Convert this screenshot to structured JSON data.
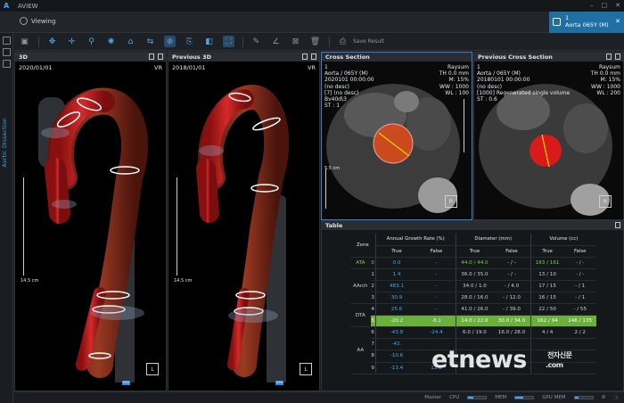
{
  "app": {
    "title": "AVIEW",
    "mode_label": "Viewing"
  },
  "window_controls": [
    "–",
    "□",
    "✕"
  ],
  "patient_tab": {
    "line1": "1",
    "line2": "Aorta 065Y (M)"
  },
  "rail": {
    "vertical_label": "Aortic Dissection"
  },
  "toolbar": {
    "icons": [
      "select-icon",
      "pointer-icon",
      "move-icon",
      "zoom-icon",
      "brightness-icon",
      "roi-icon",
      "measure-icon",
      "crosshair-icon",
      "export-icon",
      "overlay-icon",
      "fit-icon",
      "erase-icon",
      "angle-icon",
      "delete-image-icon",
      "trash-icon"
    ],
    "save_label": "Save Result"
  },
  "panels": {
    "p3d": {
      "title": "3D",
      "date": "2020/01/01",
      "mode": "VR",
      "scale": "14.5 cm",
      "orient": "L"
    },
    "prev3d": {
      "title": "Previous 3D",
      "date": "2018/01/01",
      "mode": "VR",
      "scale": "14.5 cm",
      "orient": "L"
    },
    "cross": {
      "title": "Cross Section",
      "tl": [
        "1",
        "Aorta / 065Y (M)",
        "2020101 00:00:00",
        "(no desc)",
        "[7] (no desc)",
        "Bv40d\\3",
        "ST : 1"
      ],
      "tr": [
        "Raysum",
        "TH 0.0 mm",
        "M: 15%",
        "WW : 1000",
        "WL : 100"
      ],
      "scale": "5.5 cm"
    },
    "prevcross": {
      "title": "Previous Cross Section",
      "tl": [
        "1",
        "Aorta / 065Y (M)",
        "20180101 00:00:00",
        "(no desc)",
        "[1000] Regenerated single volume",
        "ST : 0.6"
      ],
      "tr": [
        "Raysum",
        "TH 0.0 mm",
        "M: 15%",
        "WW : 1000",
        "WL : 200"
      ]
    },
    "table_title": "Table"
  },
  "table": {
    "headers": {
      "zone": "Zone",
      "growth": "Annual Growth Rate (%)",
      "diameter": "Diameter (mm)",
      "volume": "Volume (cc)",
      "true": "True",
      "false": "False"
    },
    "rows": [
      {
        "group": "ATA",
        "zone": "0",
        "g_true": "0.0",
        "g_false": "-",
        "d_true": "44.0 / 44.0",
        "d_false": "- / -",
        "v_true": "163 / 161",
        "v_false": "- / -"
      },
      {
        "group": "",
        "zone": "1",
        "g_true": "1.4",
        "g_false": "-",
        "d_true": "36.0 / 35.0",
        "d_false": "- / -",
        "v_true": "13 / 10",
        "v_false": "- / -"
      },
      {
        "group": "AArch",
        "zone": "2",
        "g_true": "483.1",
        "g_false": "-",
        "d_true": "34.0 / 1.0",
        "d_false": "- / 4.0",
        "v_true": "17 / 15",
        "v_false": "- / 1"
      },
      {
        "group": "",
        "zone": "3",
        "g_true": "30.9",
        "g_false": "-",
        "d_true": "28.0 / 16.0",
        "d_false": "- / 12.0",
        "v_true": "16 / 15",
        "v_false": "- / 1"
      },
      {
        "group": "DTA",
        "zone": "4",
        "g_true": "25.6",
        "g_false": "-",
        "d_true": "41.0 / 26.0",
        "d_false": "- / 39.0",
        "v_true": "22 / 50",
        "v_false": "- / 55"
      },
      {
        "group": "",
        "zone": "5",
        "g_true": "-20.2",
        "g_false": "-8.1",
        "d_true": "14.0 / 22.0",
        "d_false": "30.0 / 34.0",
        "v_true": "162 / 94",
        "v_false": "246 / 135"
      },
      {
        "group": "",
        "zone": "6",
        "g_true": "-43.8",
        "g_false": "-24.4",
        "d_true": "6.0 / 19.0",
        "d_false": "16.0 / 28.0",
        "v_true": "4 / 4",
        "v_false": "2 / 2"
      },
      {
        "group": "AA",
        "zone": "7",
        "g_true": "-42.",
        "g_false": "",
        "d_true": "",
        "d_false": "",
        "v_true": "",
        "v_false": ""
      },
      {
        "group": "",
        "zone": "8",
        "g_true": "-10.6",
        "g_false": "",
        "d_true": "",
        "d_false": "",
        "v_true": "",
        "v_false": ""
      },
      {
        "group": "",
        "zone": "9",
        "g_true": "-13.4",
        "g_false": "12.0",
        "d_true": "",
        "d_false": "",
        "v_true": "",
        "v_false": ""
      }
    ],
    "highlight_zone": "5"
  },
  "statusbar": {
    "master": "Master",
    "cpu": "CPU",
    "mem": "MEM",
    "gpu_mem": "GPU MEM"
  },
  "watermark": {
    "text": "etnews",
    "sub": "전자신문",
    "domain": ".com"
  },
  "colors": {
    "accent": "#3fa9f5",
    "green": "#7dd146",
    "aorta_red": "#c41e1e",
    "patient_tab": "#1f6fa5"
  }
}
